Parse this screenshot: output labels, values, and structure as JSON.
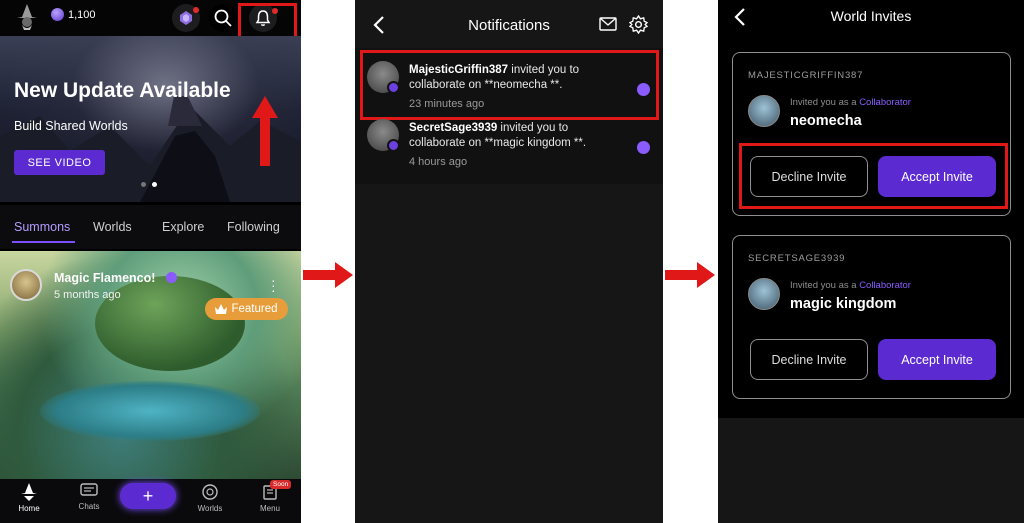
{
  "colors": {
    "accent": "#5b2bd1",
    "accent_light": "#8a5cff",
    "highlight_red": "#e01818",
    "featured": "#e89d3b"
  },
  "home": {
    "coins": "1,100",
    "hero": {
      "title": "New Update Available",
      "subtitle": "Build Shared Worlds",
      "button": "SEE VIDEO"
    },
    "tabs": [
      "Summons",
      "Worlds",
      "Explore",
      "Following"
    ],
    "active_tab": "Summons",
    "post": {
      "name": "Magic Flamenco!",
      "time": "5 months ago",
      "badge": "Featured"
    },
    "nav": {
      "home": "Home",
      "chats": "Chats",
      "create": "+",
      "worlds": "Worlds",
      "menu": "Menu",
      "soon": "Soon"
    },
    "icons": [
      "wizard-logo-icon",
      "gem-icon",
      "orb-icon",
      "search-icon",
      "bell-icon"
    ]
  },
  "notifications": {
    "title": "Notifications",
    "items": [
      {
        "user": "MajesticGriffin387",
        "text": " invited you to collaborate on **neomecha **.",
        "time": "23 minutes ago"
      },
      {
        "user": "SecretSage3939",
        "text": " invited you to collaborate on **magic kingdom **.",
        "time": "4 hours ago"
      }
    ]
  },
  "invites": {
    "title": "World Invites",
    "cards": [
      {
        "owner": "MAJESTICGRIFFIN387",
        "role_prefix": "Invited you as a ",
        "role": "Collaborator",
        "world": "neomecha",
        "decline": "Decline Invite",
        "accept": "Accept Invite"
      },
      {
        "owner": "SECRETSAGE3939",
        "role_prefix": "Invited you as a ",
        "role": "Collaborator",
        "world": "magic kingdom",
        "decline": "Decline Invite",
        "accept": "Accept Invite"
      }
    ]
  }
}
